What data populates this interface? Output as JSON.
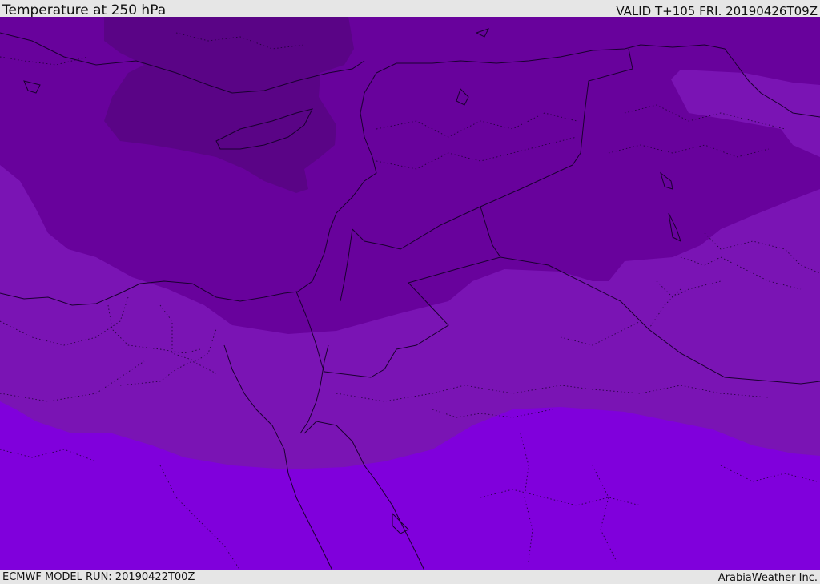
{
  "header": {
    "title": "Temperature at 250 hPa",
    "valid": "VALID T+105 FRI. 20190426T09Z"
  },
  "footer": {
    "model_run": "ECMWF MODEL RUN: 20190422T00Z",
    "credit": "ArabiaWeather Inc."
  },
  "map": {
    "field": "temperature",
    "level": "250 hPa",
    "colors": {
      "coldest_band": "#5a0486",
      "cold_band": "#68029c",
      "mid_band": "#7a14b4",
      "warm_band": "#8000dc",
      "coastline": "#1a0030",
      "border": "#1a0030"
    }
  }
}
